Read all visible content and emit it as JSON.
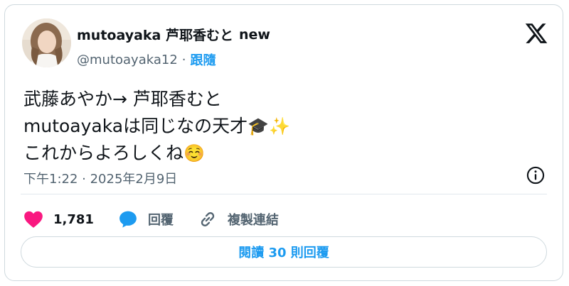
{
  "author": {
    "display_name": "mutoayaka 芦耶香むと",
    "badge_text": "new",
    "handle": "@mutoayaka12",
    "separator": "·",
    "follow_label": "跟隨"
  },
  "tweet": {
    "lines": [
      "武藤あやか→ 芦耶香むと",
      "mutoayakaは同じなの天才",
      "これからよろしくね"
    ],
    "emoji_line2": "🎓✨",
    "emoji_line3": "☺️",
    "timestamp": "下午1:22 · 2025年2月9日"
  },
  "actions": {
    "like_count": "1,781",
    "reply_label": "回覆",
    "copy_link_label": "複製連結"
  },
  "read_replies_label": "閱讀 30 則回覆",
  "colors": {
    "accent": "#1d9bf0",
    "like": "#f91880",
    "muted": "#536471",
    "text": "#0f1419",
    "border": "#cfd9de"
  },
  "icons": {
    "logo": "x-logo-icon",
    "info": "info-icon",
    "like": "heart-icon",
    "reply": "speech-bubble-icon",
    "copy": "link-icon"
  }
}
